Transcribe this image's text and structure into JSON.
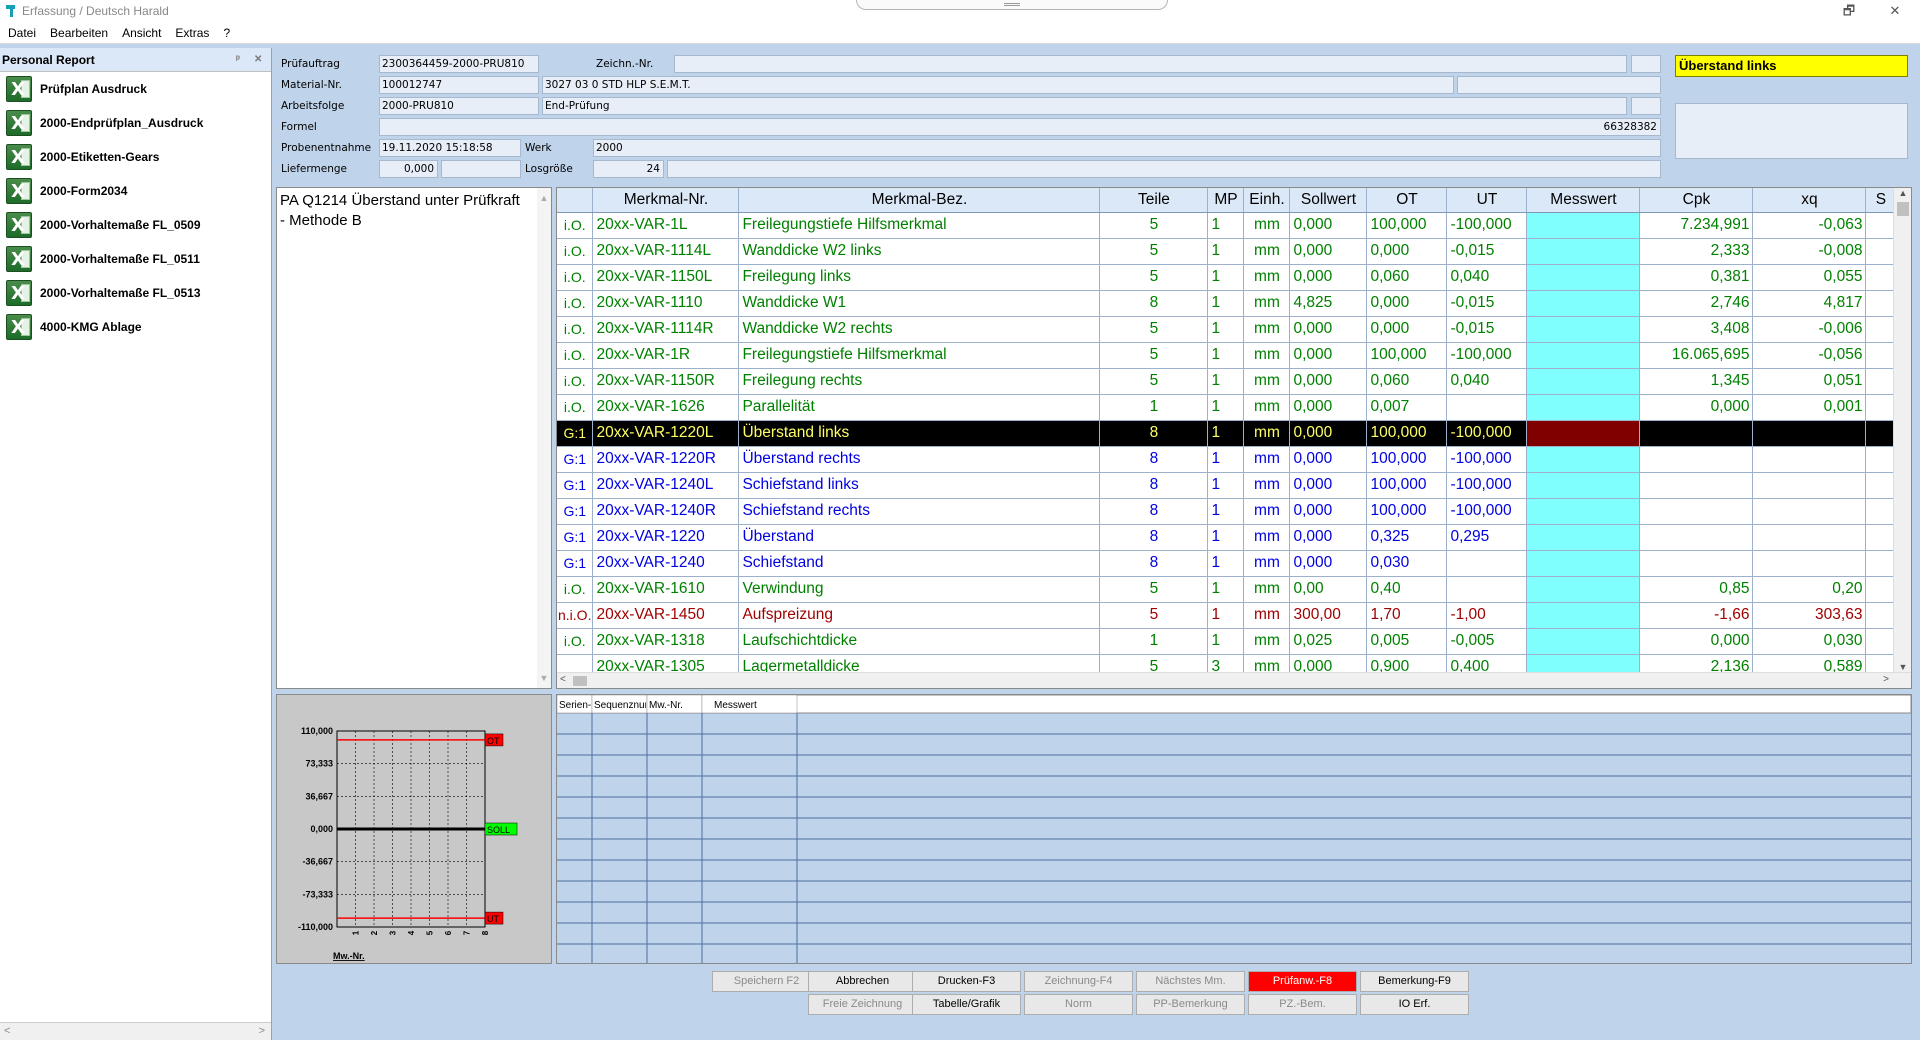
{
  "window": {
    "title": "Erfassung / Deutsch Harald",
    "restore_glyph": "🗗",
    "close_glyph": "✕"
  },
  "menu": [
    {
      "label": "Datei"
    },
    {
      "label": "Bearbeiten"
    },
    {
      "label": "Ansicht"
    },
    {
      "label": "Extras"
    },
    {
      "label": "?"
    }
  ],
  "personal_report": {
    "title": "Personal Report",
    "pin_glyph": "ᵖ",
    "close_glyph": "✕",
    "items": [
      "Prüfplan Ausdruck",
      "2000-Endprüfplan_Ausdruck",
      "2000-Etiketten-Gears",
      "2000-Form2034",
      "2000-Vorhaltemaße FL_0509",
      "2000-Vorhaltemaße FL_0511",
      "2000-Vorhaltemaße FL_0513",
      "4000-KMG Ablage"
    ],
    "scroll_left": "<",
    "scroll_right": ">"
  },
  "form": {
    "pruefauftrag_label": "Prüfauftrag",
    "pruefauftrag": "2300364459-2000-PRU810",
    "zeichn_label": "Zeichn.-Nr.",
    "zeichn": "",
    "material_label": "Material-Nr.",
    "material": "100012747",
    "material_desc": "3027 03 0 STD HLP S.E.M.T.",
    "arbeitsfolge_label": "Arbeitsfolge",
    "arbeitsfolge": "2000-PRU810",
    "arbeitsfolge_desc": "End-Prüfung",
    "formel_label": "Formel",
    "formel_value": "66328382",
    "probenentnahme_label": "Probenentnahme",
    "probenentnahme": "19.11.2020 15:18:58",
    "werk_label": "Werk",
    "werk": "2000",
    "liefermenge_label": "Liefermenge",
    "liefermenge": "0,000",
    "losgroesse_label": "Losgröße",
    "losgroesse": "24"
  },
  "status_box": "Überstand links",
  "description": "PA Q1214 Überstand unter Prüfkraft - Methode B",
  "desc_scroll": {
    "up": "▲",
    "down": "▼"
  },
  "table": {
    "headers": [
      "",
      "Merkmal-Nr.",
      "Merkmal-Bez.",
      "Teile",
      "MP",
      "Einh.",
      "Sollwert",
      "OT",
      "UT",
      "Messwert",
      "Cpk",
      "xq",
      "S"
    ],
    "rows": [
      {
        "style": "green",
        "status": "i.O.",
        "nr": "20xx-VAR-1L",
        "bez": "Freilegungstiefe Hilfsmerkmal",
        "teile": "5",
        "mp": "1",
        "einh": "mm",
        "soll": "0,000",
        "ot": "100,000",
        "ut": "-100,000",
        "mess": "",
        "cpk": "7.234,991",
        "xq": "-0,063"
      },
      {
        "style": "green",
        "status": "i.O.",
        "nr": "20xx-VAR-1114L",
        "bez": "Wanddicke W2 links",
        "teile": "5",
        "mp": "1",
        "einh": "mm",
        "soll": "0,000",
        "ot": "0,000",
        "ut": "-0,015",
        "mess": "",
        "cpk": "2,333",
        "xq": "-0,008"
      },
      {
        "style": "green",
        "status": "i.O.",
        "nr": "20xx-VAR-1150L",
        "bez": "Freilegung links",
        "teile": "5",
        "mp": "1",
        "einh": "mm",
        "soll": "0,000",
        "ot": "0,060",
        "ut": "0,040",
        "mess": "",
        "cpk": "0,381",
        "xq": "0,055"
      },
      {
        "style": "green",
        "status": "i.O.",
        "nr": "20xx-VAR-1110",
        "bez": "Wanddicke W1",
        "teile": "8",
        "mp": "1",
        "einh": "mm",
        "soll": "4,825",
        "ot": "0,000",
        "ut": "-0,015",
        "mess": "",
        "cpk": "2,746",
        "xq": "4,817"
      },
      {
        "style": "green",
        "status": "i.O.",
        "nr": "20xx-VAR-1114R",
        "bez": "Wanddicke W2 rechts",
        "teile": "5",
        "mp": "1",
        "einh": "mm",
        "soll": "0,000",
        "ot": "0,000",
        "ut": "-0,015",
        "mess": "",
        "cpk": "3,408",
        "xq": "-0,006"
      },
      {
        "style": "green",
        "status": "i.O.",
        "nr": "20xx-VAR-1R",
        "bez": "Freilegungstiefe Hilfsmerkmal",
        "teile": "5",
        "mp": "1",
        "einh": "mm",
        "soll": "0,000",
        "ot": "100,000",
        "ut": "-100,000",
        "mess": "",
        "cpk": "16.065,695",
        "xq": "-0,056"
      },
      {
        "style": "green",
        "status": "i.O.",
        "nr": "20xx-VAR-1150R",
        "bez": "Freilegung rechts",
        "teile": "5",
        "mp": "1",
        "einh": "mm",
        "soll": "0,000",
        "ot": "0,060",
        "ut": "0,040",
        "mess": "",
        "cpk": "1,345",
        "xq": "0,051"
      },
      {
        "style": "green",
        "status": "i.O.",
        "nr": "20xx-VAR-1626",
        "bez": "Parallelität",
        "teile": "1",
        "mp": "1",
        "einh": "mm",
        "soll": "0,000",
        "ot": "0,007",
        "ut": "",
        "mess": "",
        "cpk": "0,000",
        "xq": "0,001"
      },
      {
        "style": "sel",
        "status": "G:1",
        "nr": "20xx-VAR-1220L",
        "bez": "Überstand links",
        "teile": "8",
        "mp": "1",
        "einh": "mm",
        "soll": "0,000",
        "ot": "100,000",
        "ut": "-100,000",
        "mess": "",
        "cpk": "",
        "xq": ""
      },
      {
        "style": "blue",
        "status": "G:1",
        "nr": "20xx-VAR-1220R",
        "bez": "Überstand rechts",
        "teile": "8",
        "mp": "1",
        "einh": "mm",
        "soll": "0,000",
        "ot": "100,000",
        "ut": "-100,000",
        "mess": "",
        "cpk": "",
        "xq": ""
      },
      {
        "style": "blue",
        "status": "G:1",
        "nr": "20xx-VAR-1240L",
        "bez": "Schiefstand links",
        "teile": "8",
        "mp": "1",
        "einh": "mm",
        "soll": "0,000",
        "ot": "100,000",
        "ut": "-100,000",
        "mess": "",
        "cpk": "",
        "xq": ""
      },
      {
        "style": "blue",
        "status": "G:1",
        "nr": "20xx-VAR-1240R",
        "bez": "Schiefstand rechts",
        "teile": "8",
        "mp": "1",
        "einh": "mm",
        "soll": "0,000",
        "ot": "100,000",
        "ut": "-100,000",
        "mess": "",
        "cpk": "",
        "xq": ""
      },
      {
        "style": "blue",
        "status": "G:1",
        "nr": "20xx-VAR-1220",
        "bez": "Überstand",
        "teile": "8",
        "mp": "1",
        "einh": "mm",
        "soll": "0,000",
        "ot": "0,325",
        "ut": "0,295",
        "mess": "",
        "cpk": "",
        "xq": ""
      },
      {
        "style": "blue",
        "status": "G:1",
        "nr": "20xx-VAR-1240",
        "bez": "Schiefstand",
        "teile": "8",
        "mp": "1",
        "einh": "mm",
        "soll": "0,000",
        "ot": "0,030",
        "ut": "",
        "mess": "",
        "cpk": "",
        "xq": ""
      },
      {
        "style": "green",
        "status": "i.O.",
        "nr": "20xx-VAR-1610",
        "bez": "Verwindung",
        "teile": "5",
        "mp": "1",
        "einh": "mm",
        "soll": "0,00",
        "ot": "0,40",
        "ut": "",
        "mess": "",
        "cpk": "0,85",
        "xq": "0,20"
      },
      {
        "style": "red",
        "status": "n.i.O.",
        "nr": "20xx-VAR-1450",
        "bez": "Aufspreizung",
        "teile": "5",
        "mp": "1",
        "einh": "mm",
        "soll": "300,00",
        "ot": "1,70",
        "ut": "-1,00",
        "mess": "",
        "cpk": "-1,66",
        "xq": "303,63"
      },
      {
        "style": "green",
        "status": "i.O.",
        "nr": "20xx-VAR-1318",
        "bez": "Laufschichtdicke",
        "teile": "1",
        "mp": "1",
        "einh": "mm",
        "soll": "0,025",
        "ot": "0,005",
        "ut": "-0,005",
        "mess": "",
        "cpk": "0,000",
        "xq": "0,030"
      },
      {
        "style": "green",
        "status": "",
        "nr": "20xx-VAR-1305",
        "bez": "Lagermetalldicke",
        "teile": "5",
        "mp": "3",
        "einh": "mm",
        "soll": "0,000",
        "ot": "0,900",
        "ut": "0,400",
        "mess": "",
        "cpk": "2,136",
        "xq": "0,589"
      }
    ],
    "scroll": {
      "up": "▲",
      "down": "▼",
      "left": "<",
      "right": ">"
    }
  },
  "chart_data": {
    "type": "line",
    "title": "",
    "xlabel": "Mw.-Nr.",
    "ylabel": "",
    "x_ticks": [
      "1",
      "2",
      "3",
      "4",
      "5",
      "6",
      "7",
      "8"
    ],
    "y_ticks": [
      "110,000",
      "73,333",
      "36,667",
      "0,000",
      "-36,667",
      "-73,333",
      "-110,000"
    ],
    "ylim": [
      -110,
      110
    ],
    "limits": [
      {
        "label": "OT",
        "value": 100,
        "color": "#ff0000"
      },
      {
        "label": "SOLL",
        "value": 0,
        "color": "#000000"
      },
      {
        "label": "UT",
        "value": -100,
        "color": "#ff0000"
      }
    ],
    "series": [],
    "grid": true
  },
  "lower_grid": {
    "headers": [
      "Serien-Nr.",
      "Sequenznummer",
      "Mw.-Nr.",
      "Messwert"
    ]
  },
  "buttons": {
    "row1": [
      {
        "label": "Speichern F2",
        "state": "disabled"
      },
      {
        "label": "Abbrechen",
        "state": "normal"
      },
      {
        "label": "Drucken-F3",
        "state": "normal"
      },
      {
        "label": "Zeichnung-F4",
        "state": "disabled"
      },
      {
        "label": "Nächstes Mm.",
        "state": "disabled"
      },
      {
        "label": "Prüfanw.-F8",
        "state": "red"
      },
      {
        "label": "Bemerkung-F9",
        "state": "normal"
      }
    ],
    "row2": [
      {
        "label": "Freie Zeichnung",
        "state": "disabled"
      },
      {
        "label": "Tabelle/Grafik",
        "state": "normal"
      },
      {
        "label": "Norm",
        "state": "disabled"
      },
      {
        "label": "PP-Bemerkung",
        "state": "disabled"
      },
      {
        "label": "PZ.-Bem.",
        "state": "disabled"
      },
      {
        "label": "IO Erf.",
        "state": "normal"
      }
    ]
  }
}
